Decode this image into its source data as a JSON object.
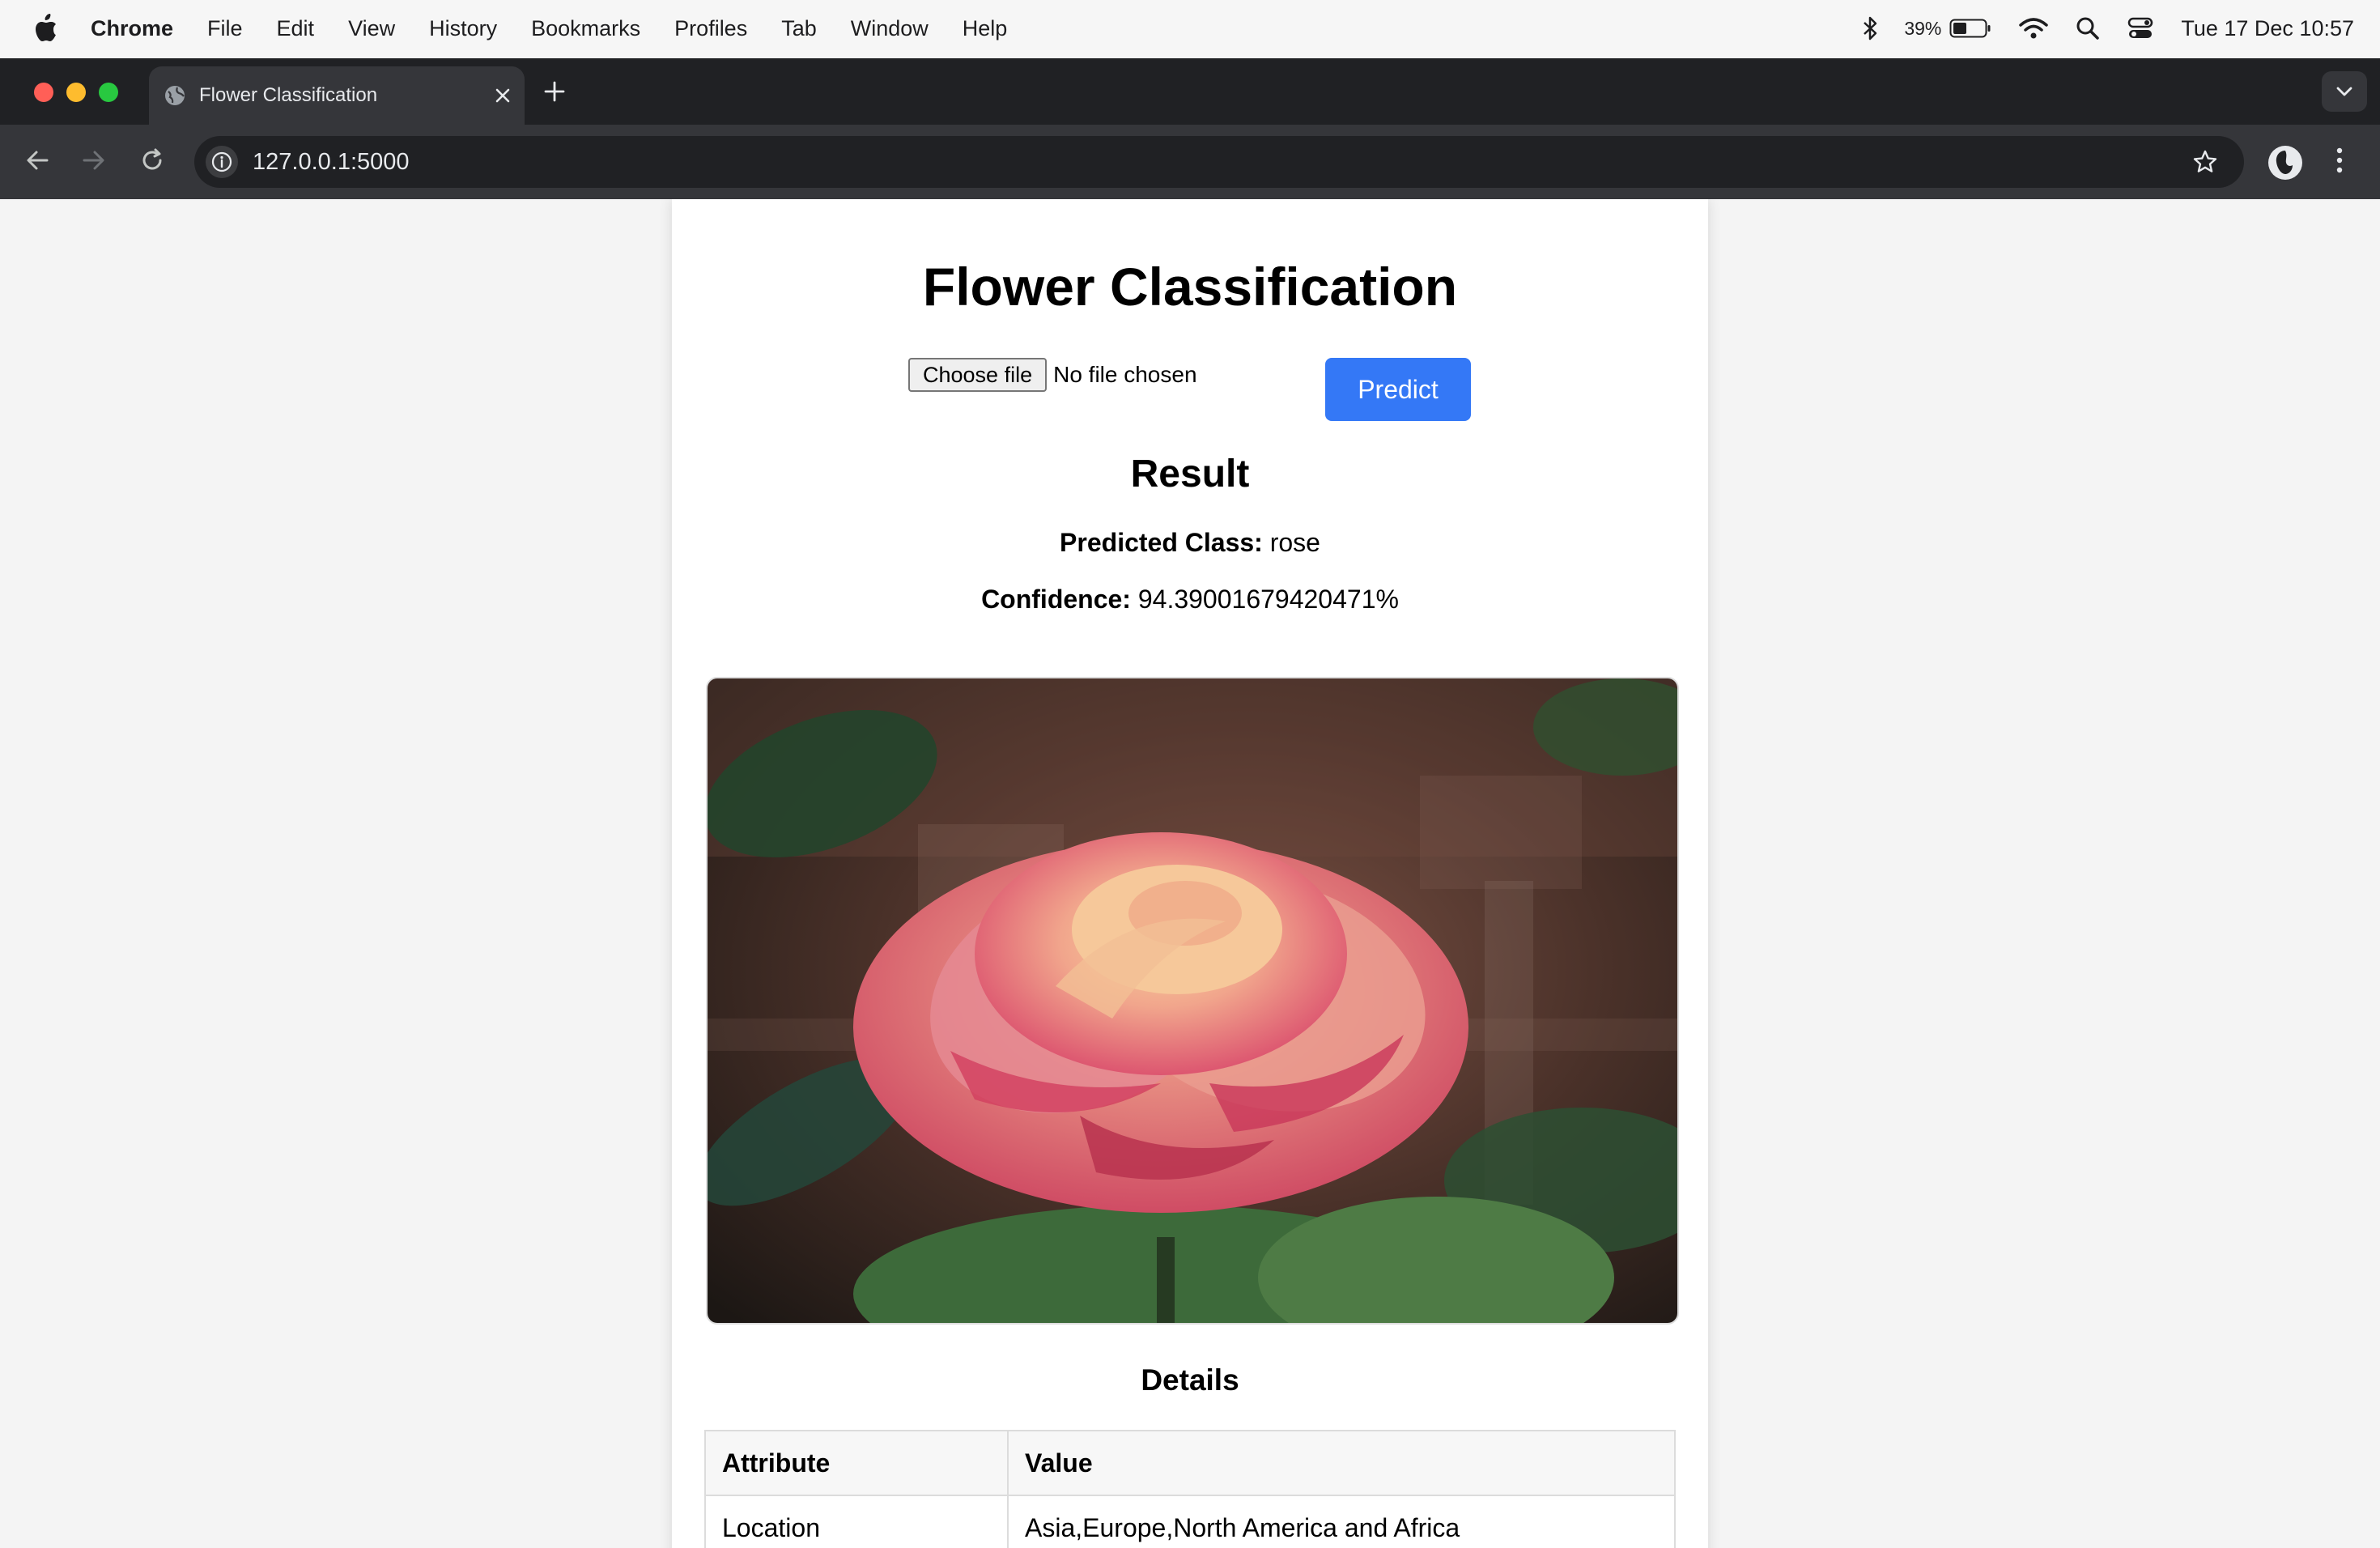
{
  "menubar": {
    "app_name": "Chrome",
    "items": [
      "File",
      "Edit",
      "View",
      "History",
      "Bookmarks",
      "Profiles",
      "Tab",
      "Window",
      "Help"
    ],
    "battery_percent": "39%",
    "clock": "Tue 17 Dec  10:57"
  },
  "browser": {
    "tab_title": "Flower Classification",
    "url": "127.0.0.1:5000"
  },
  "page": {
    "title": "Flower Classification",
    "choose_file_label": "Choose file",
    "file_status": "No file chosen",
    "predict_label": "Predict",
    "result_heading": "Result",
    "predicted_class_label": "Predicted Class:",
    "predicted_class_value": " rose",
    "confidence_label": "Confidence:",
    "confidence_value": " 94.39001679420471%",
    "details_heading": "Details",
    "details_table": {
      "headers": [
        "Attribute",
        "Value"
      ],
      "rows": [
        [
          "Location",
          "Asia,Europe,North America and Africa"
        ]
      ]
    }
  },
  "colors": {
    "predict_button": "#3478f6",
    "chrome_dark": "#202124",
    "chrome_toolbar": "#35363a"
  }
}
